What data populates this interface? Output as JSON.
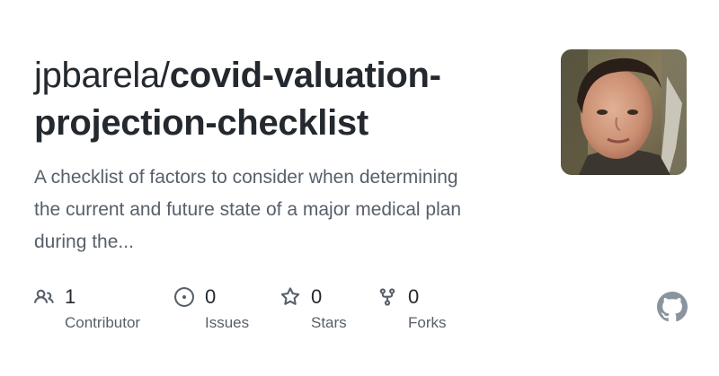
{
  "repo": {
    "owner": "jpbarela/",
    "name_line1": "covid-valuation-",
    "name_line2": "projection-checklist",
    "description_line1": "A checklist of factors to consider when determining",
    "description_line2": "the current and future state of a major medical plan",
    "description_line3": "during the..."
  },
  "stats": {
    "contributors": {
      "value": "1",
      "label": "Contributor",
      "icon": "people-icon"
    },
    "issues": {
      "value": "0",
      "label": "Issues",
      "icon": "issue-opened-icon"
    },
    "stars": {
      "value": "0",
      "label": "Stars",
      "icon": "star-icon"
    },
    "forks": {
      "value": "0",
      "label": "Forks",
      "icon": "repo-forked-icon"
    }
  },
  "brand": {
    "logo": "github-mark-icon",
    "logo_color": "#8b949e"
  },
  "colors": {
    "title": "#24292f",
    "muted": "#57606a",
    "icon": "#57606a"
  }
}
